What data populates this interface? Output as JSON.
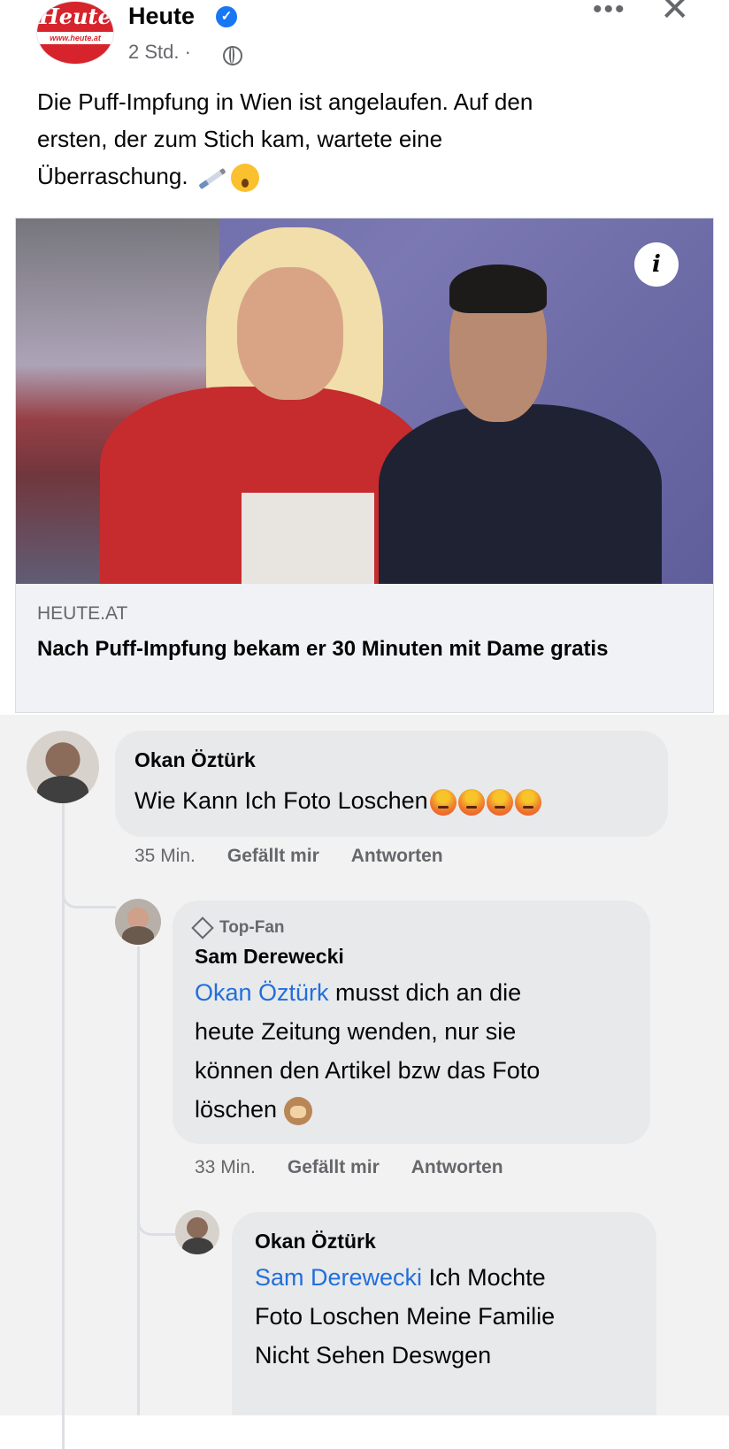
{
  "post": {
    "page_name": "Heute",
    "logo_text": "Heute",
    "logo_url_text": "www.heute.at",
    "time": "2 Std. ·",
    "text_line1": "Die Puff-Impfung in Wien ist angelaufen. Auf den",
    "text_line2": "ersten, der zum Stich kam, wartete eine",
    "text_line3": "Überraschung.",
    "icons": [
      "verified-icon",
      "globe-icon",
      "more-icon",
      "close-icon",
      "syringe-icon",
      "shocked-face-emoji"
    ]
  },
  "link": {
    "domain": "HEUTE.AT",
    "title": "Nach Puff-Impfung bekam er 30 Minuten mit Dame gratis",
    "info_label": "i"
  },
  "comments": [
    {
      "author": "Okan Öztürk",
      "text": "Wie Kann Ich Foto Loschen",
      "time": "35 Min.",
      "like": "Gefällt mir",
      "reply": "Antworten"
    },
    {
      "badge": "Top-Fan",
      "author": "Sam Derewecki",
      "mention": "Okan Öztürk",
      "text_line1": " musst dich an die",
      "text_line2": "heute Zeitung wenden, nur sie",
      "text_line3": "können den Artikel bzw das Foto",
      "text_line4": "löschen",
      "time": "33 Min.",
      "like": "Gefällt mir",
      "reply": "Antworten"
    },
    {
      "author": "Okan Öztürk",
      "mention": "Sam Derewecki",
      "text_line1": "  Ich Mochte",
      "text_line2": "Foto Loschen Meine Familie",
      "text_line3": "Nicht Sehen Deswgen"
    }
  ],
  "colors": {
    "brand_red": "#d7232b",
    "mention_blue": "#216fdb",
    "meta_gray": "#65676b"
  }
}
